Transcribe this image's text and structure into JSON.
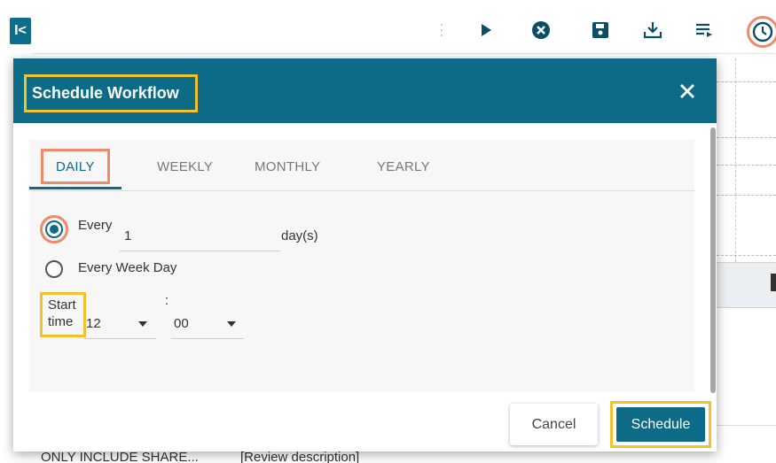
{
  "toolbar": {
    "collapse_glyph": "I<",
    "icons": [
      "drag-handle-icon",
      "play-icon",
      "stop-icon",
      "save-icon",
      "download-icon",
      "list-icon",
      "clock-icon"
    ]
  },
  "background": {
    "bottom_select_value": "ONLY INCLUDE SHARE...",
    "bottom_text": "[Review description]"
  },
  "dialog": {
    "title": "Schedule Workflow",
    "tabs": [
      {
        "label": "DAILY",
        "active": true
      },
      {
        "label": "WEEKLY",
        "active": false
      },
      {
        "label": "MONTHLY",
        "active": false
      },
      {
        "label": "YEARLY",
        "active": false
      }
    ],
    "options": {
      "every_label": "Every",
      "every_value": "1",
      "every_unit": "day(s)",
      "every_week_day_label": "Every Week Day",
      "selected": "every"
    },
    "start_time": {
      "label_line1": "Start",
      "label_line2": "time",
      "separator": ":",
      "hour": "12",
      "minute": "00"
    },
    "buttons": {
      "cancel": "Cancel",
      "schedule": "Schedule"
    }
  },
  "colors": {
    "primary": "#0d6b87",
    "highlight_yellow": "#f2c12e",
    "highlight_orange": "#f08a6a"
  }
}
